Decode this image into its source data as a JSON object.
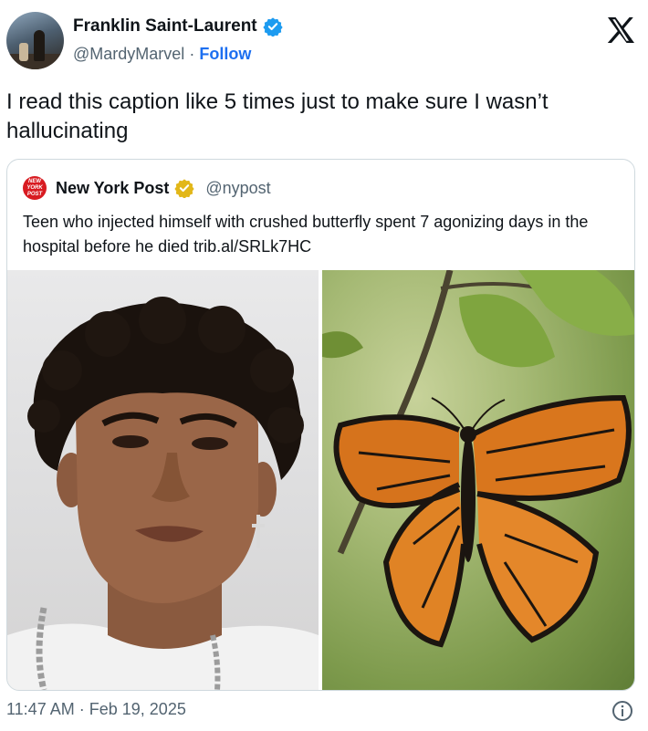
{
  "author": {
    "display_name": "Franklin Saint-Laurent",
    "handle": "@MardyMarvel",
    "separator": "·",
    "follow_label": "Follow",
    "verified_icon": "verified-badge-icon"
  },
  "tweet": {
    "text": "I read this caption like 5 times just to make sure I wasn’t hallucinating"
  },
  "quoted": {
    "logo_text": "NEW YORK POST",
    "display_name": "New York Post",
    "handle": "@nypost",
    "verified_icon": "gold-verified-badge-icon",
    "text": "Teen who injected himself with crushed butterfly spent 7 agonizing days in the hospital before he died trib.al/SRLk7HC",
    "media": [
      "teen-portrait-photo",
      "monarch-butterfly-photo"
    ]
  },
  "footer": {
    "time": "11:47 AM",
    "separator": "·",
    "date": "Feb 19, 2025"
  },
  "colors": {
    "link": "#1d6ff0",
    "verified_blue": "#1d9bf0",
    "verified_gold": "#e2b719",
    "nyp_red": "#d81b21",
    "secondary_text": "#536471"
  }
}
